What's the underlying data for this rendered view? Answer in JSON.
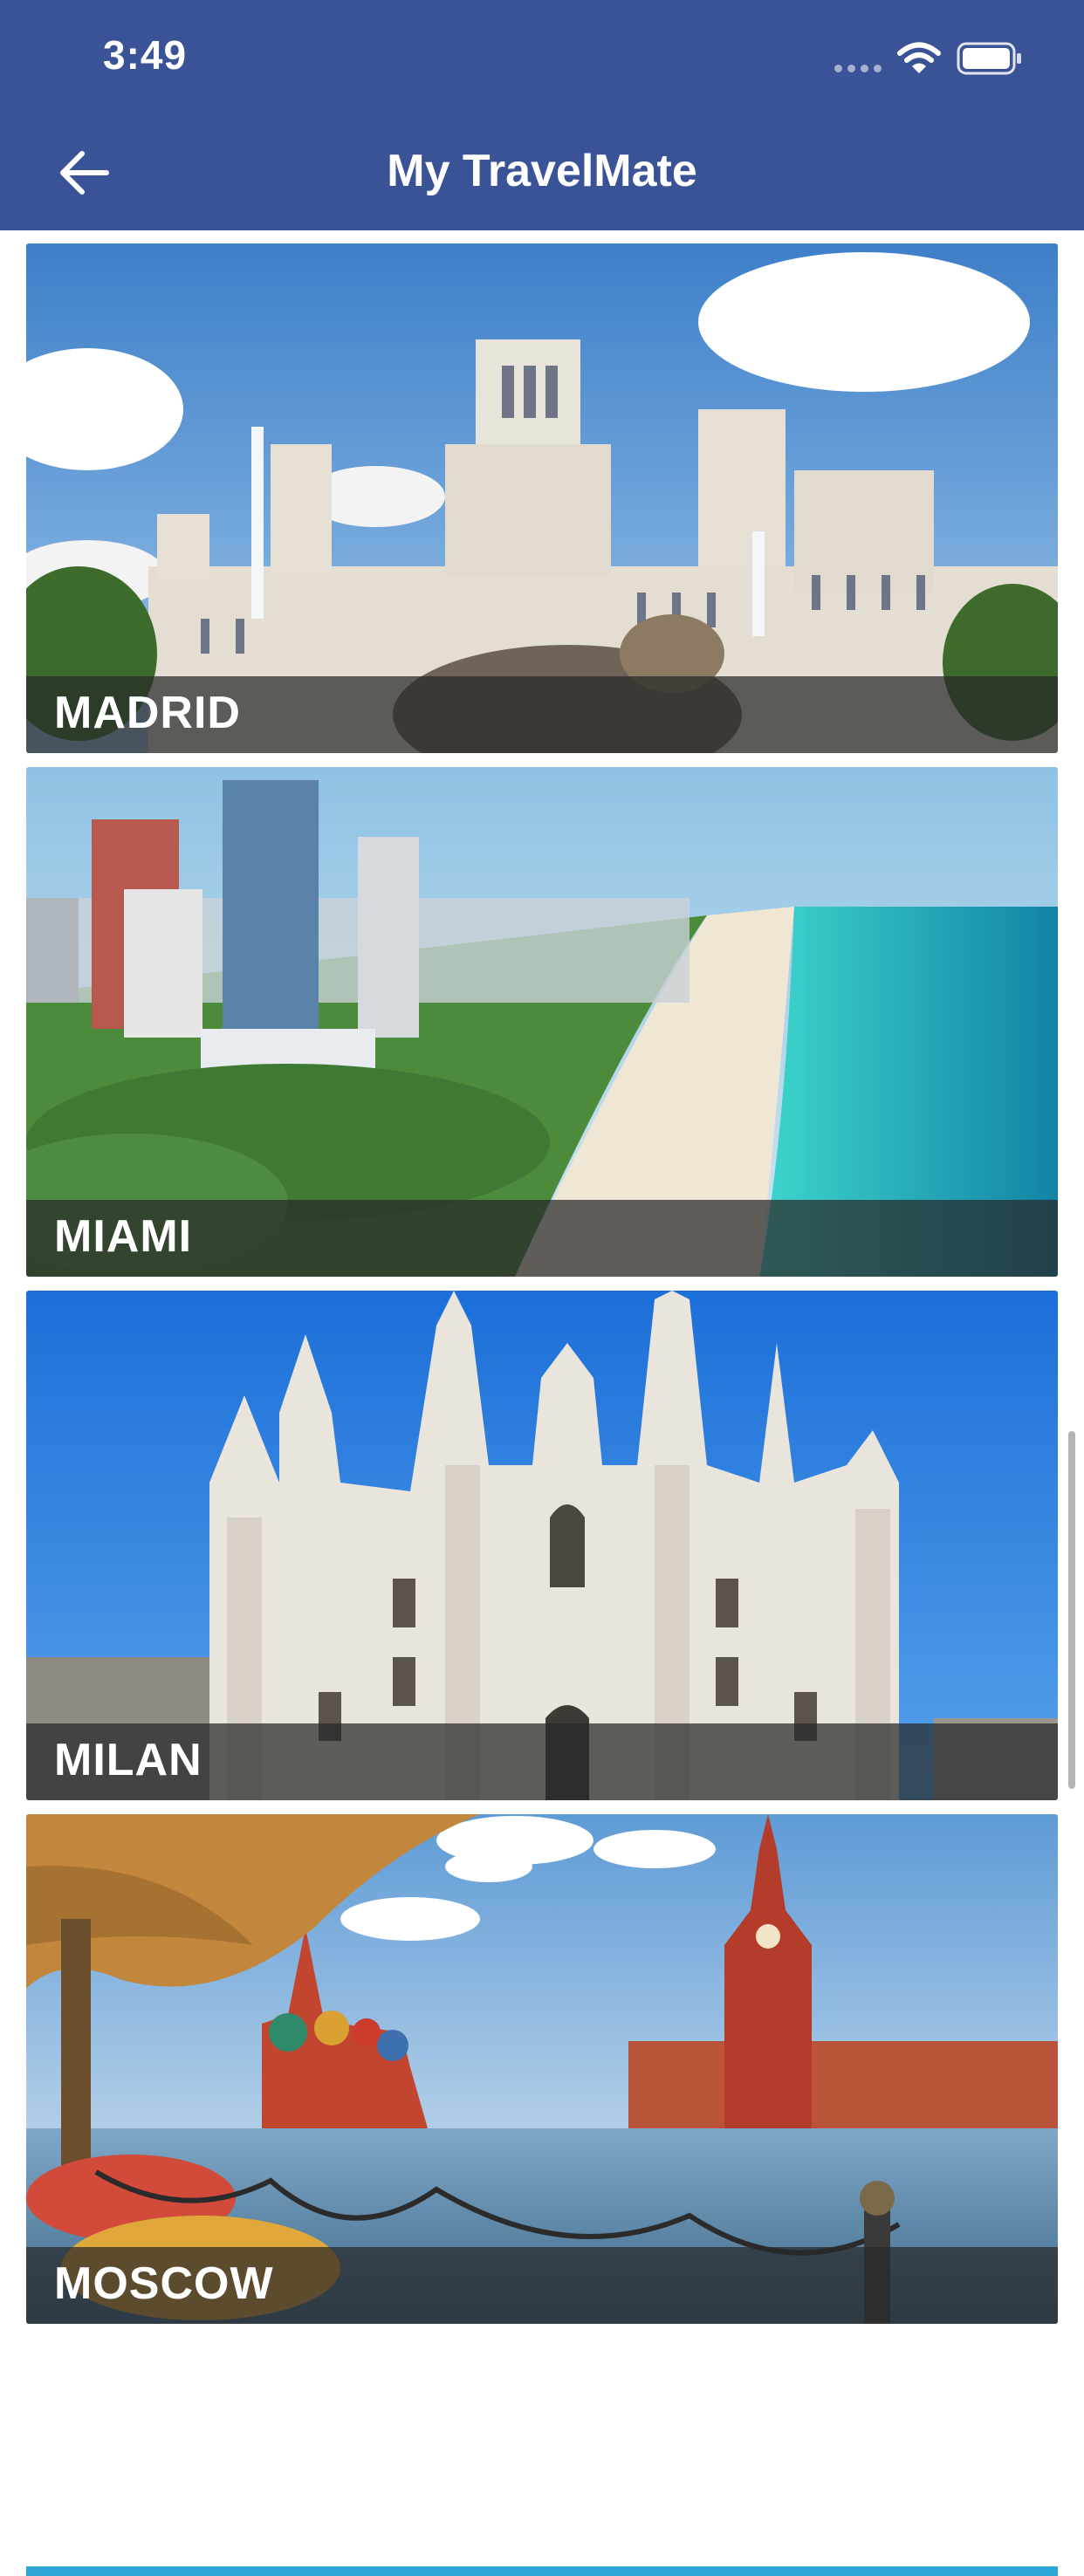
{
  "status_bar": {
    "time": "3:49"
  },
  "header": {
    "title": "My TravelMate"
  },
  "cities": [
    {
      "name": "MADRID"
    },
    {
      "name": "MIAMI"
    },
    {
      "name": "MILAN"
    },
    {
      "name": "MOSCOW"
    }
  ],
  "colors": {
    "header_bg": "#3A5296",
    "caption_bg": "rgba(40,40,40,0.72)"
  },
  "icons": {
    "back": "arrow-left-icon",
    "wifi": "wifi-icon",
    "battery": "battery-icon"
  }
}
